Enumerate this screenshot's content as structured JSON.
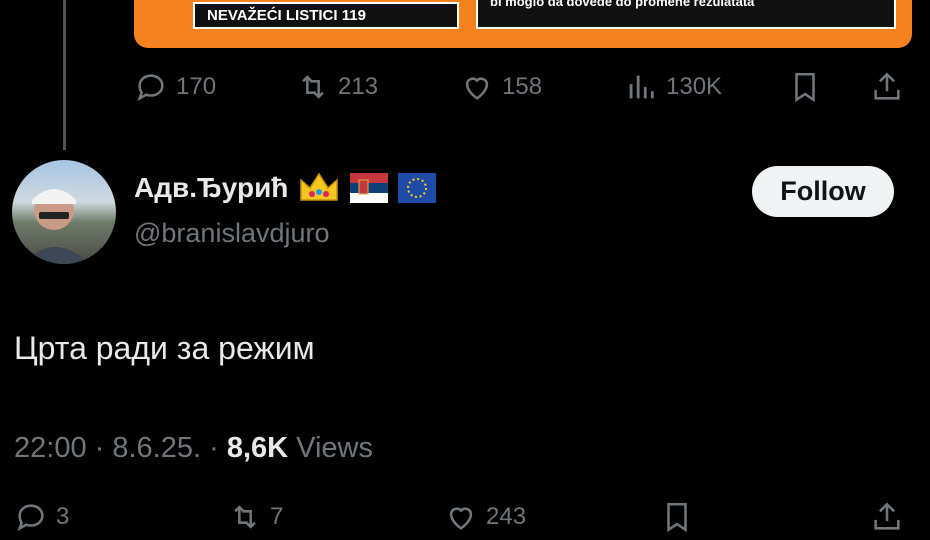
{
  "prev_tweet": {
    "card_box1": "NEVAŽEĆI LISTICI  119",
    "card_box2": "bi moglo da dovede do promene rezulatata",
    "replies": "170",
    "reposts": "213",
    "likes": "158",
    "views": "130K"
  },
  "tweet": {
    "display_name": "Адв.Ђурић",
    "badges": [
      "crown-emoji",
      "serbia-flag-emoji",
      "eu-flag-emoji"
    ],
    "handle": "@branislavdjuro",
    "follow_label": "Follow",
    "text": "Црта ради за режим",
    "time": "22:00",
    "date": "8.6.25.",
    "views_count": "8,6K",
    "views_label": "Views",
    "replies": "3",
    "reposts": "7",
    "likes": "243"
  },
  "colors": {
    "accent_orange": "#f5821f",
    "muted": "#71767b",
    "text": "#e7e9ea"
  }
}
